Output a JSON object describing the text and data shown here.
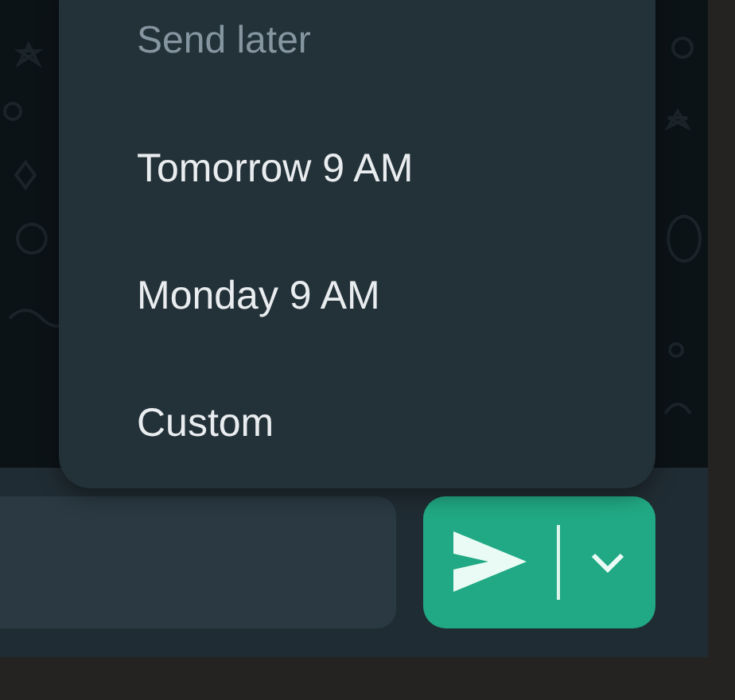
{
  "send_later_menu": {
    "title": "Send later",
    "items": [
      {
        "label": "Tomorrow 9 AM"
      },
      {
        "label": "Monday 9 AM"
      },
      {
        "label": "Custom"
      }
    ]
  }
}
